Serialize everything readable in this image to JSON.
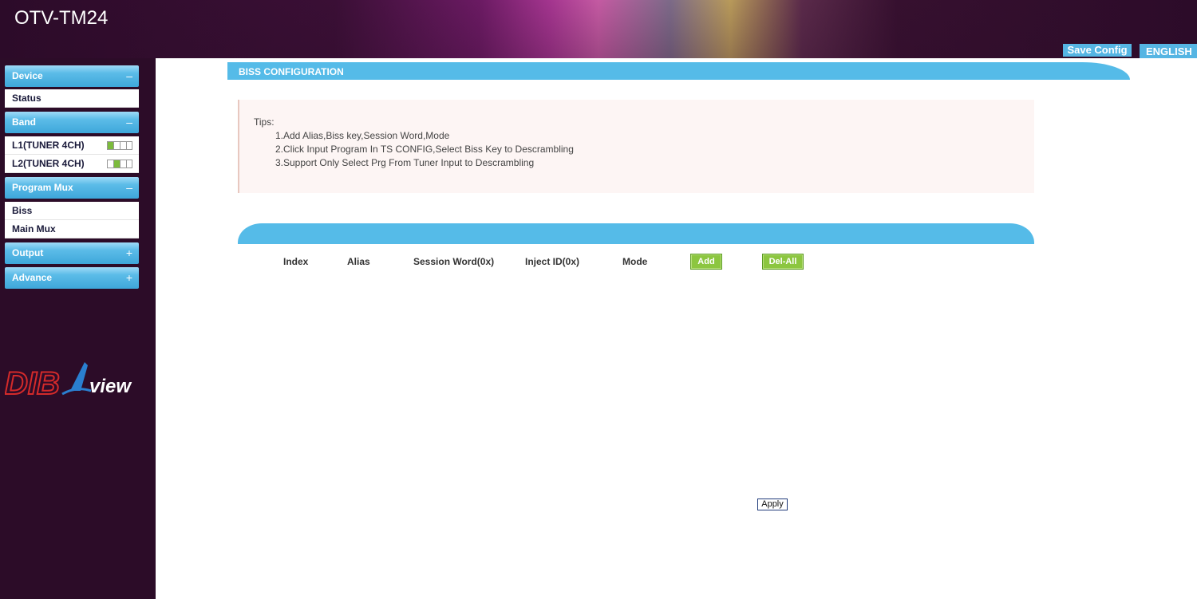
{
  "header": {
    "title": "OTV-TM24",
    "save_config": "Save Config",
    "language": "ENGLISH"
  },
  "sidebar": {
    "sections": [
      {
        "label": "Device",
        "sign": "–",
        "items": [
          {
            "label": "Status"
          }
        ]
      },
      {
        "label": "Band",
        "sign": "–",
        "items": [
          {
            "label": "L1(TUNER 4CH)"
          },
          {
            "label": "L2(TUNER 4CH)"
          }
        ]
      },
      {
        "label": "Program Mux",
        "sign": "–",
        "items": [
          {
            "label": "Biss"
          },
          {
            "label": "Main Mux"
          }
        ]
      },
      {
        "label": "Output",
        "sign": "+",
        "items": []
      },
      {
        "label": "Advance",
        "sign": "+",
        "items": []
      }
    ],
    "logo": {
      "left": "DIB",
      "right": "view"
    }
  },
  "main": {
    "section_title": "BISS CONFIGURATION",
    "tips": {
      "heading": "Tips:",
      "lines": [
        "1.Add Alias,Biss key,Session Word,Mode",
        "2.Click Input Program In TS CONFIG,Select Biss Key to Descrambling",
        "3.Support Only Select Prg From Tuner Input to Descrambling"
      ]
    },
    "table": {
      "columns": [
        "Index",
        "Alias",
        "Session Word(0x)",
        "Inject ID(0x)",
        "Mode"
      ],
      "add_label": "Add",
      "del_all_label": "Del-All"
    },
    "apply_label": "Apply"
  },
  "colors": {
    "accent_blue": "#55bbe8",
    "sidebar_bg": "#2c0c28",
    "button_green": "#8cc640"
  }
}
